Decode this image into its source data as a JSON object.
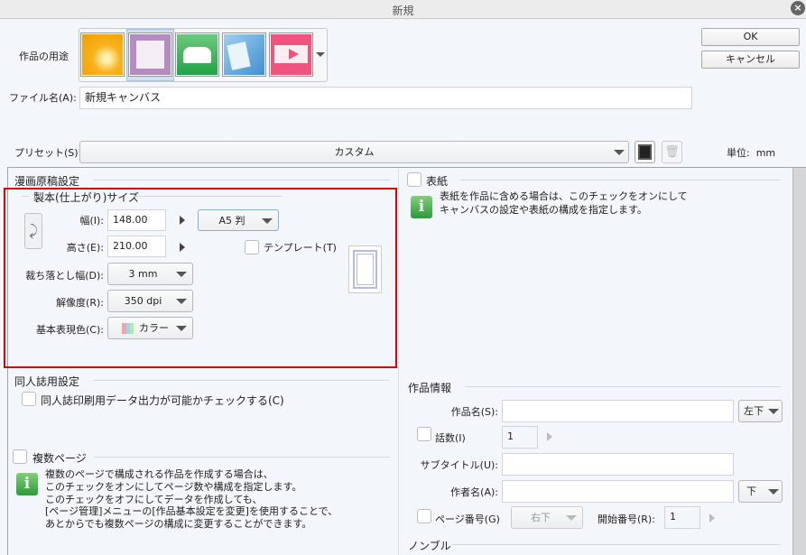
{
  "window": {
    "title": "新規"
  },
  "usage": {
    "label": "作品の用途",
    "icons": [
      "illustration-icon",
      "comic-icon",
      "book-icon",
      "all-settings-icon",
      "animation-icon"
    ]
  },
  "buttons": {
    "ok": "OK",
    "cancel": "キャンセル"
  },
  "file_name": {
    "label": "ファイル名(A):",
    "value": "新規キャンバス"
  },
  "preset": {
    "label": "プリセット(S):",
    "value": "カスタム",
    "unit_label": "単位:",
    "unit": "mm"
  },
  "comic": {
    "section": "漫画原稿設定",
    "size_group": "製本(仕上がり)サイズ",
    "width_label": "幅(I):",
    "width": "148.00",
    "height_label": "高さ(E):",
    "height": "210.00",
    "paper": "A5 判",
    "template": "テンプレート(T)",
    "bleed_label": "裁ち落とし幅(D):",
    "bleed": "3 mm",
    "resolution_label": "解像度(R):",
    "resolution": "350 dpi",
    "color_label": "基本表現色(C):",
    "color": "カラー"
  },
  "doujin": {
    "section": "同人誌用設定",
    "check": "同人誌印刷用データ出力が可能かチェックする(C)"
  },
  "multi": {
    "label": "複数ページ",
    "info": [
      "複数のページで構成される作品を作成する場合は、",
      "このチェックをオンにしてページ数や構成を指定します。",
      "このチェックをオフにしてデータを作成しても、",
      "[ページ管理]メニューの[作品基本設定を変更]を使用することで、",
      "あとからでも複数ページの構成に変更することができます。"
    ]
  },
  "cover": {
    "label": "表紙",
    "info": [
      "表紙を作品に含める場合は、このチェックをオンにして",
      "キャンバスの設定や表紙の構成を指定します。"
    ]
  },
  "work_info": {
    "section": "作品情報",
    "title_label": "作品名(S):",
    "title_pos": "左下",
    "episode_label": "話数(I)",
    "episode": "1",
    "subtitle_label": "サブタイトル(U):",
    "author_label": "作者名(A):",
    "author_pos": "下",
    "page_no_label": "ページ番号(G)",
    "page_no_pos": "右下",
    "start_label": "開始番号(R):",
    "start": "1"
  },
  "nombre": {
    "section": "ノンブル"
  },
  "colors": {
    "highlight": "#e00000",
    "panel_bg": "#f3f6fa"
  }
}
